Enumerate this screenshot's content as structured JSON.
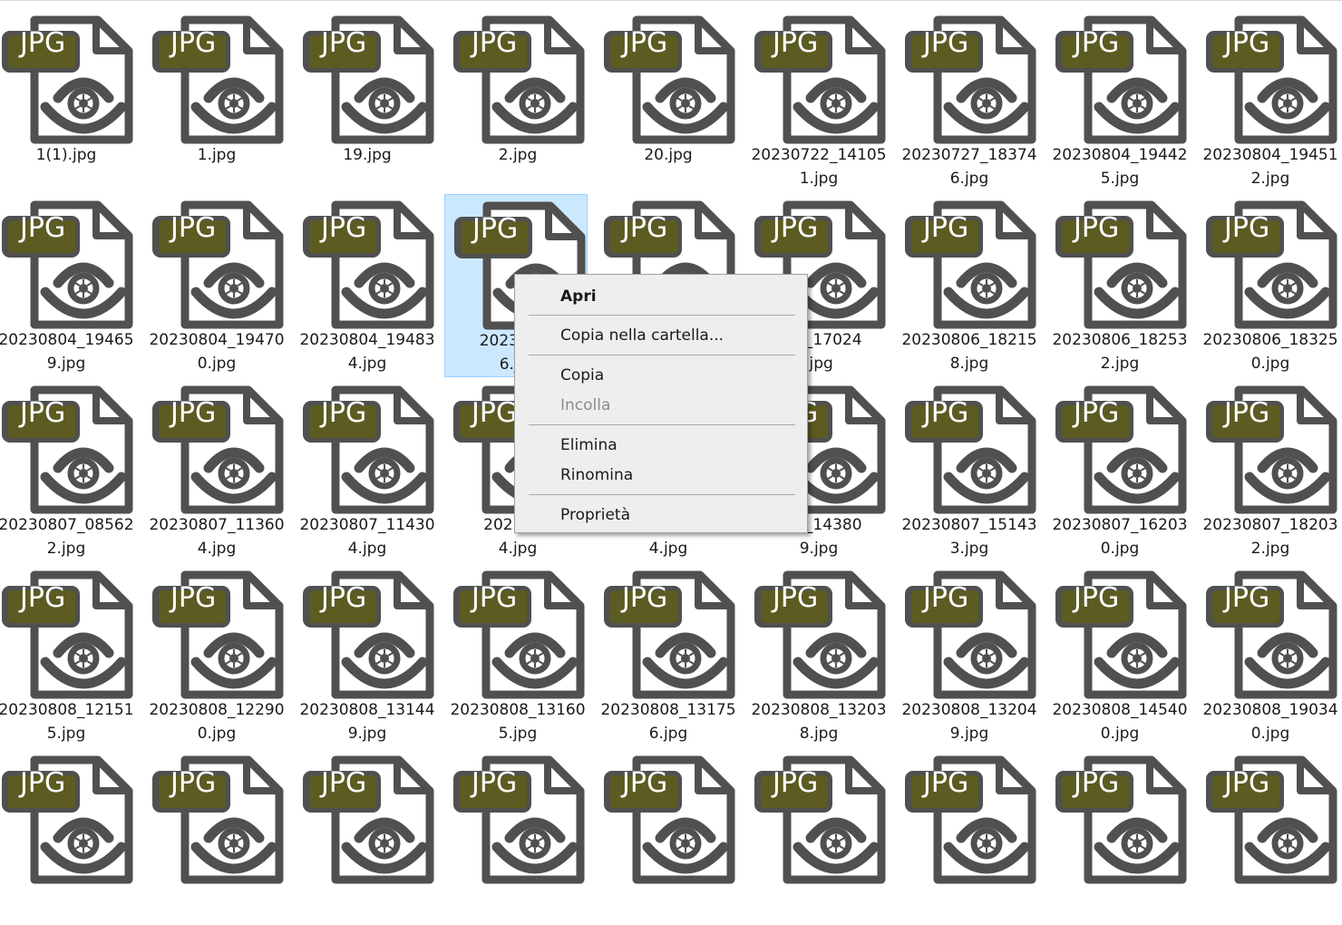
{
  "icon": {
    "type_label": "JPG",
    "icon_name": "jpg-file-icon",
    "colors": {
      "frame": "#505050",
      "badge": "#5c5b22",
      "badge_text": "#ffffff",
      "selection": "#cce8ff"
    }
  },
  "files": [
    {
      "line1": "1(1).jpg",
      "line2": ""
    },
    {
      "line1": "1.jpg",
      "line2": ""
    },
    {
      "line1": "19.jpg",
      "line2": ""
    },
    {
      "line1": "2.jpg",
      "line2": ""
    },
    {
      "line1": "20.jpg",
      "line2": ""
    },
    {
      "line1": "20230722_14105",
      "line2": "1.jpg"
    },
    {
      "line1": "20230727_18374",
      "line2": "6.jpg"
    },
    {
      "line1": "20230804_19442",
      "line2": "5.jpg"
    },
    {
      "line1": "20230804_19451",
      "line2": "2.jpg"
    },
    {
      "line1": "20230804_19465",
      "line2": "9.jpg"
    },
    {
      "line1": "20230804_19470",
      "line2": "0.jpg"
    },
    {
      "line1": "20230804_19483",
      "line2": "4.jpg"
    },
    {
      "line1": "20230804",
      "line2": "6.jpg",
      "selected": true
    },
    {
      "line1": "",
      "line2": ""
    },
    {
      "line1": "806_17024",
      "line2": ".jpg"
    },
    {
      "line1": "20230806_18215",
      "line2": "8.jpg"
    },
    {
      "line1": "20230806_18253",
      "line2": "2.jpg"
    },
    {
      "line1": "20230806_18325",
      "line2": "0.jpg"
    },
    {
      "line1": "20230807_08562",
      "line2": "2.jpg"
    },
    {
      "line1": "20230807_11360",
      "line2": "4.jpg"
    },
    {
      "line1": "20230807_11430",
      "line2": "4.jpg"
    },
    {
      "line1": "2023080",
      "line2": "4.jpg"
    },
    {
      "line1": "",
      "line2": "4.jpg"
    },
    {
      "line1": "807_14380",
      "line2": "9.jpg"
    },
    {
      "line1": "20230807_15143",
      "line2": "3.jpg"
    },
    {
      "line1": "20230807_16203",
      "line2": "0.jpg"
    },
    {
      "line1": "20230807_18203",
      "line2": "2.jpg"
    },
    {
      "line1": "20230808_12151",
      "line2": "5.jpg"
    },
    {
      "line1": "20230808_12290",
      "line2": "0.jpg"
    },
    {
      "line1": "20230808_13144",
      "line2": "9.jpg"
    },
    {
      "line1": "20230808_13160",
      "line2": "5.jpg"
    },
    {
      "line1": "20230808_13175",
      "line2": "6.jpg"
    },
    {
      "line1": "20230808_13203",
      "line2": "8.jpg"
    },
    {
      "line1": "20230808_13204",
      "line2": "9.jpg"
    },
    {
      "line1": "20230808_14540",
      "line2": "0.jpg"
    },
    {
      "line1": "20230808_19034",
      "line2": "0.jpg"
    },
    {
      "line1": "",
      "line2": ""
    },
    {
      "line1": "",
      "line2": ""
    },
    {
      "line1": "",
      "line2": ""
    },
    {
      "line1": "",
      "line2": ""
    },
    {
      "line1": "",
      "line2": ""
    },
    {
      "line1": "",
      "line2": ""
    },
    {
      "line1": "",
      "line2": ""
    },
    {
      "line1": "",
      "line2": ""
    },
    {
      "line1": "",
      "line2": ""
    }
  ],
  "context_menu": {
    "items": [
      {
        "label": "Apri",
        "bold": true,
        "enabled": true
      },
      {
        "label": "Copia nella cartella...",
        "enabled": true
      },
      {
        "label": "Copia",
        "enabled": true
      },
      {
        "label": "Incolla",
        "enabled": false
      },
      {
        "label": "Elimina",
        "enabled": true
      },
      {
        "label": "Rinomina",
        "enabled": true
      },
      {
        "label": "Proprietà",
        "enabled": true
      }
    ]
  }
}
